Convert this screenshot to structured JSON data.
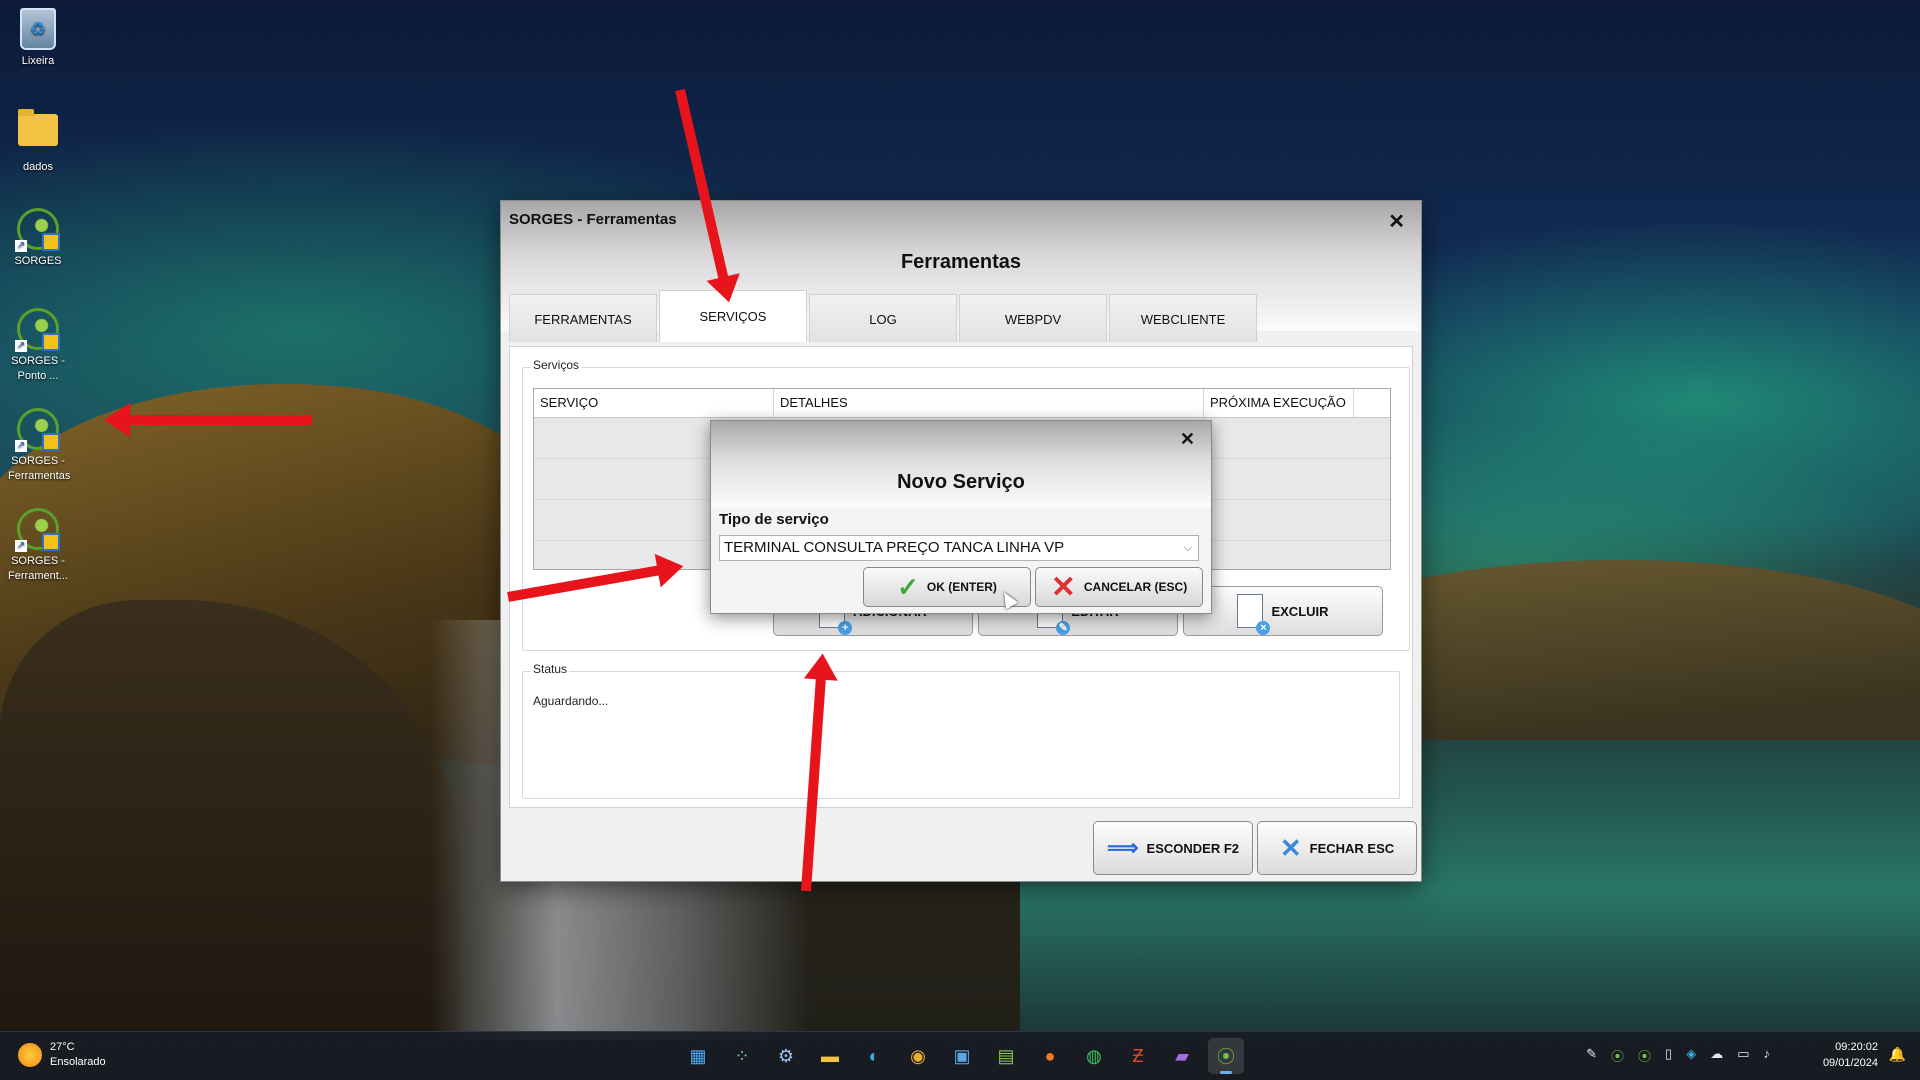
{
  "desktop": {
    "icons": [
      {
        "label": "Lixeira"
      },
      {
        "label": "dados"
      },
      {
        "label": "SORGES"
      },
      {
        "label": "SORGES - Ponto ..."
      },
      {
        "label": "SORGES - Ferramentas"
      },
      {
        "label": "SORGES - Ferrament..."
      }
    ]
  },
  "window": {
    "title": "SORGES - Ferramentas",
    "heading": "Ferramentas",
    "close_glyph": "✕",
    "tabs": [
      {
        "label": "FERRAMENTAS"
      },
      {
        "label": "SERVIÇOS",
        "active": true
      },
      {
        "label": "LOG"
      },
      {
        "label": "WEBPDV"
      },
      {
        "label": "WEBCLIENTE"
      }
    ],
    "services_group": "Serviços",
    "grid_columns": [
      "SERVIÇO",
      "DETALHES",
      "PRÓXIMA EXECUÇÃO"
    ],
    "action_buttons": {
      "add": "ADICIONAR",
      "edit": "EDITAR",
      "delete": "EXCLUIR"
    },
    "status_group": "Status",
    "status_text": "Aguardando...",
    "footer": {
      "hide": "ESCONDER F2",
      "close": "FECHAR ESC"
    }
  },
  "dialog": {
    "heading": "Novo Serviço",
    "close_glyph": "✕",
    "label": "Tipo de serviço",
    "selected": "TERMINAL CONSULTA PREÇO TANCA LINHA VP",
    "ok": "OK (ENTER)",
    "cancel": "CANCELAR (ESC)"
  },
  "taskbar": {
    "temperature": "27°C",
    "weather": "Ensolarado",
    "time": "09:20:02",
    "date": "09/01/2024",
    "apps": [
      "start-icon",
      "widgets-icon",
      "settings-icon",
      "file-explorer-icon",
      "edge-icon",
      "chrome-icon",
      "remote-icon",
      "notepad-icon",
      "firefox-icon",
      "whatsapp-icon",
      "filezilla-icon",
      "video-editor-icon",
      "sorges-icon"
    ]
  },
  "colors": {
    "arrow": "#e8141c",
    "accent": "#6ab0f0"
  }
}
